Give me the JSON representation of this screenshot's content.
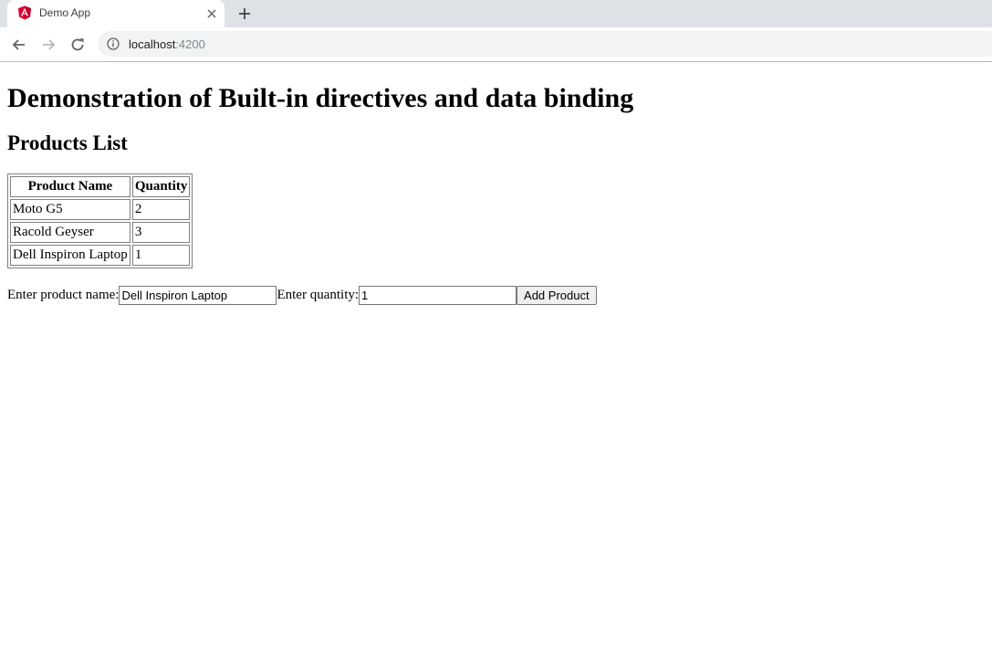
{
  "browser": {
    "tab": {
      "title": "Demo App",
      "favicon": "angular-logo-icon",
      "favicon_color": "#dd0031"
    },
    "nav": {
      "back": "back-arrow-icon",
      "forward": "forward-arrow-icon",
      "reload": "reload-icon"
    },
    "address": {
      "host": "localhost",
      "port": ":4200"
    }
  },
  "page": {
    "heading": "Demonstration of Built-in directives and data binding",
    "subheading": "Products List",
    "table": {
      "headers": [
        "Product Name",
        "Quantity"
      ],
      "rows": [
        [
          "Moto G5",
          "2"
        ],
        [
          "Racold Geyser",
          "3"
        ],
        [
          "Dell Inspiron Laptop",
          "1"
        ]
      ]
    },
    "form": {
      "name_label": "Enter product name:",
      "name_value": "Dell Inspiron Laptop",
      "qty_label": "Enter quantity:",
      "qty_value": "1",
      "submit_label": "Add Product"
    }
  }
}
